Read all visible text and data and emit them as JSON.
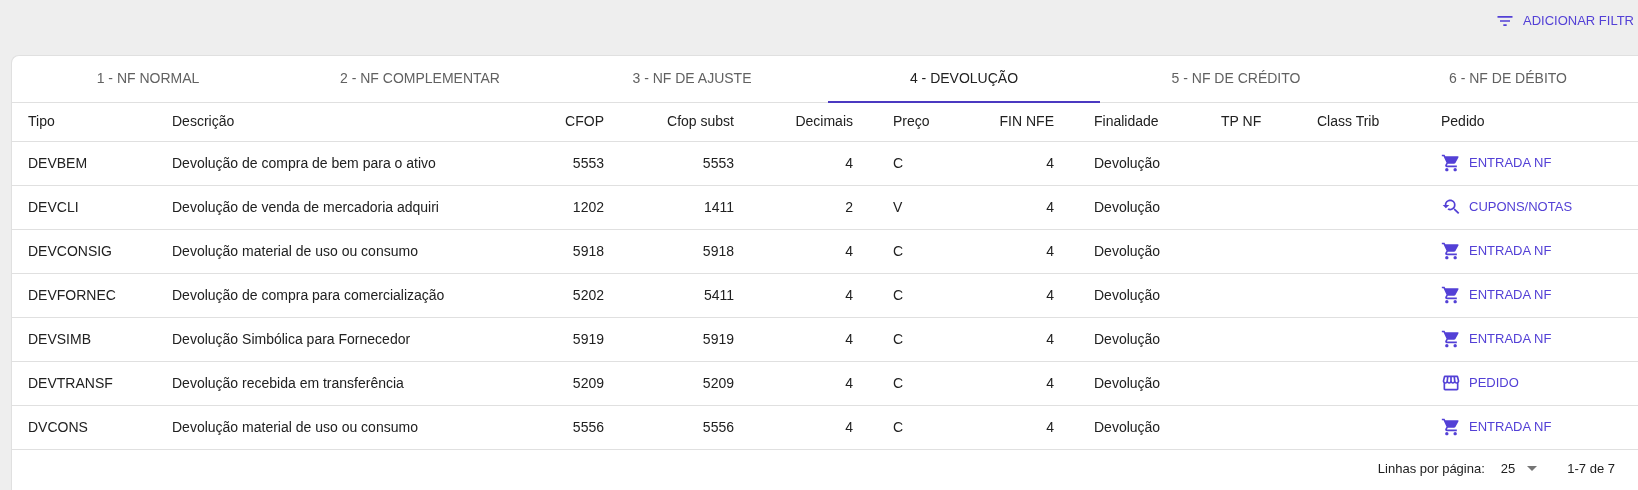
{
  "toolbar": {
    "filter_button": "ADICIONAR FILTR"
  },
  "tabs": [
    {
      "label": "1 - NF NORMAL",
      "selected": false
    },
    {
      "label": "2 - NF COMPLEMENTAR",
      "selected": false
    },
    {
      "label": "3 - NF DE AJUSTE",
      "selected": false
    },
    {
      "label": "4 - DEVOLUÇÃO",
      "selected": true
    },
    {
      "label": "5 - NF DE CRÉDITO",
      "selected": false
    },
    {
      "label": "6 - NF DE DÉBITO",
      "selected": false
    }
  ],
  "table": {
    "columns": [
      "Tipo",
      "Descrição",
      "CFOP",
      "Cfop subst",
      "Decimais",
      "Preço",
      "FIN NFE",
      "Finalidade",
      "TP NF",
      "Class Trib",
      "Pedido"
    ],
    "rows": [
      {
        "tipo": "DEVBEM",
        "descricao": "Devolução de compra de bem para o ativo",
        "cfop": "5553",
        "cfop_subst": "5553",
        "decimais": "4",
        "preco": "C",
        "fin_nfe": "4",
        "finalidade": "Devolução",
        "pedido": {
          "kind": "cart",
          "label": "ENTRADA NF"
        }
      },
      {
        "tipo": "DEVCLI",
        "descricao": "Devolução de venda de mercadoria adquiri",
        "cfop": "1202",
        "cfop_subst": "1411",
        "decimais": "2",
        "preco": "V",
        "fin_nfe": "4",
        "finalidade": "Devolução",
        "pedido": {
          "kind": "search",
          "label": "CUPONS/NOTAS"
        }
      },
      {
        "tipo": "DEVCONSIG",
        "descricao": "Devolução material de uso ou consumo",
        "cfop": "5918",
        "cfop_subst": "5918",
        "decimais": "4",
        "preco": "C",
        "fin_nfe": "4",
        "finalidade": "Devolução",
        "pedido": {
          "kind": "cart",
          "label": "ENTRADA NF"
        }
      },
      {
        "tipo": "DEVFORNEC",
        "descricao": "Devolução de compra para comercialização",
        "cfop": "5202",
        "cfop_subst": "5411",
        "decimais": "4",
        "preco": "C",
        "fin_nfe": "4",
        "finalidade": "Devolução",
        "pedido": {
          "kind": "cart",
          "label": "ENTRADA NF"
        }
      },
      {
        "tipo": "DEVSIMB",
        "descricao": "Devolução Simbólica para Fornecedor",
        "cfop": "5919",
        "cfop_subst": "5919",
        "decimais": "4",
        "preco": "C",
        "fin_nfe": "4",
        "finalidade": "Devolução",
        "pedido": {
          "kind": "cart",
          "label": "ENTRADA NF"
        }
      },
      {
        "tipo": "DEVTRANSF",
        "descricao": "Devolução recebida em transferência",
        "cfop": "5209",
        "cfop_subst": "5209",
        "decimais": "4",
        "preco": "C",
        "fin_nfe": "4",
        "finalidade": "Devolução",
        "pedido": {
          "kind": "store",
          "label": "PEDIDO"
        }
      },
      {
        "tipo": "DVCONS",
        "descricao": "Devolução material de uso ou consumo",
        "cfop": "5556",
        "cfop_subst": "5556",
        "decimais": "4",
        "preco": "C",
        "fin_nfe": "4",
        "finalidade": "Devolução",
        "pedido": {
          "kind": "cart",
          "label": "ENTRADA NF"
        }
      }
    ]
  },
  "pagination": {
    "rows_per_page_label": "Linhas por página:",
    "rows_per_page": "25",
    "range": "1-7 de 7"
  }
}
